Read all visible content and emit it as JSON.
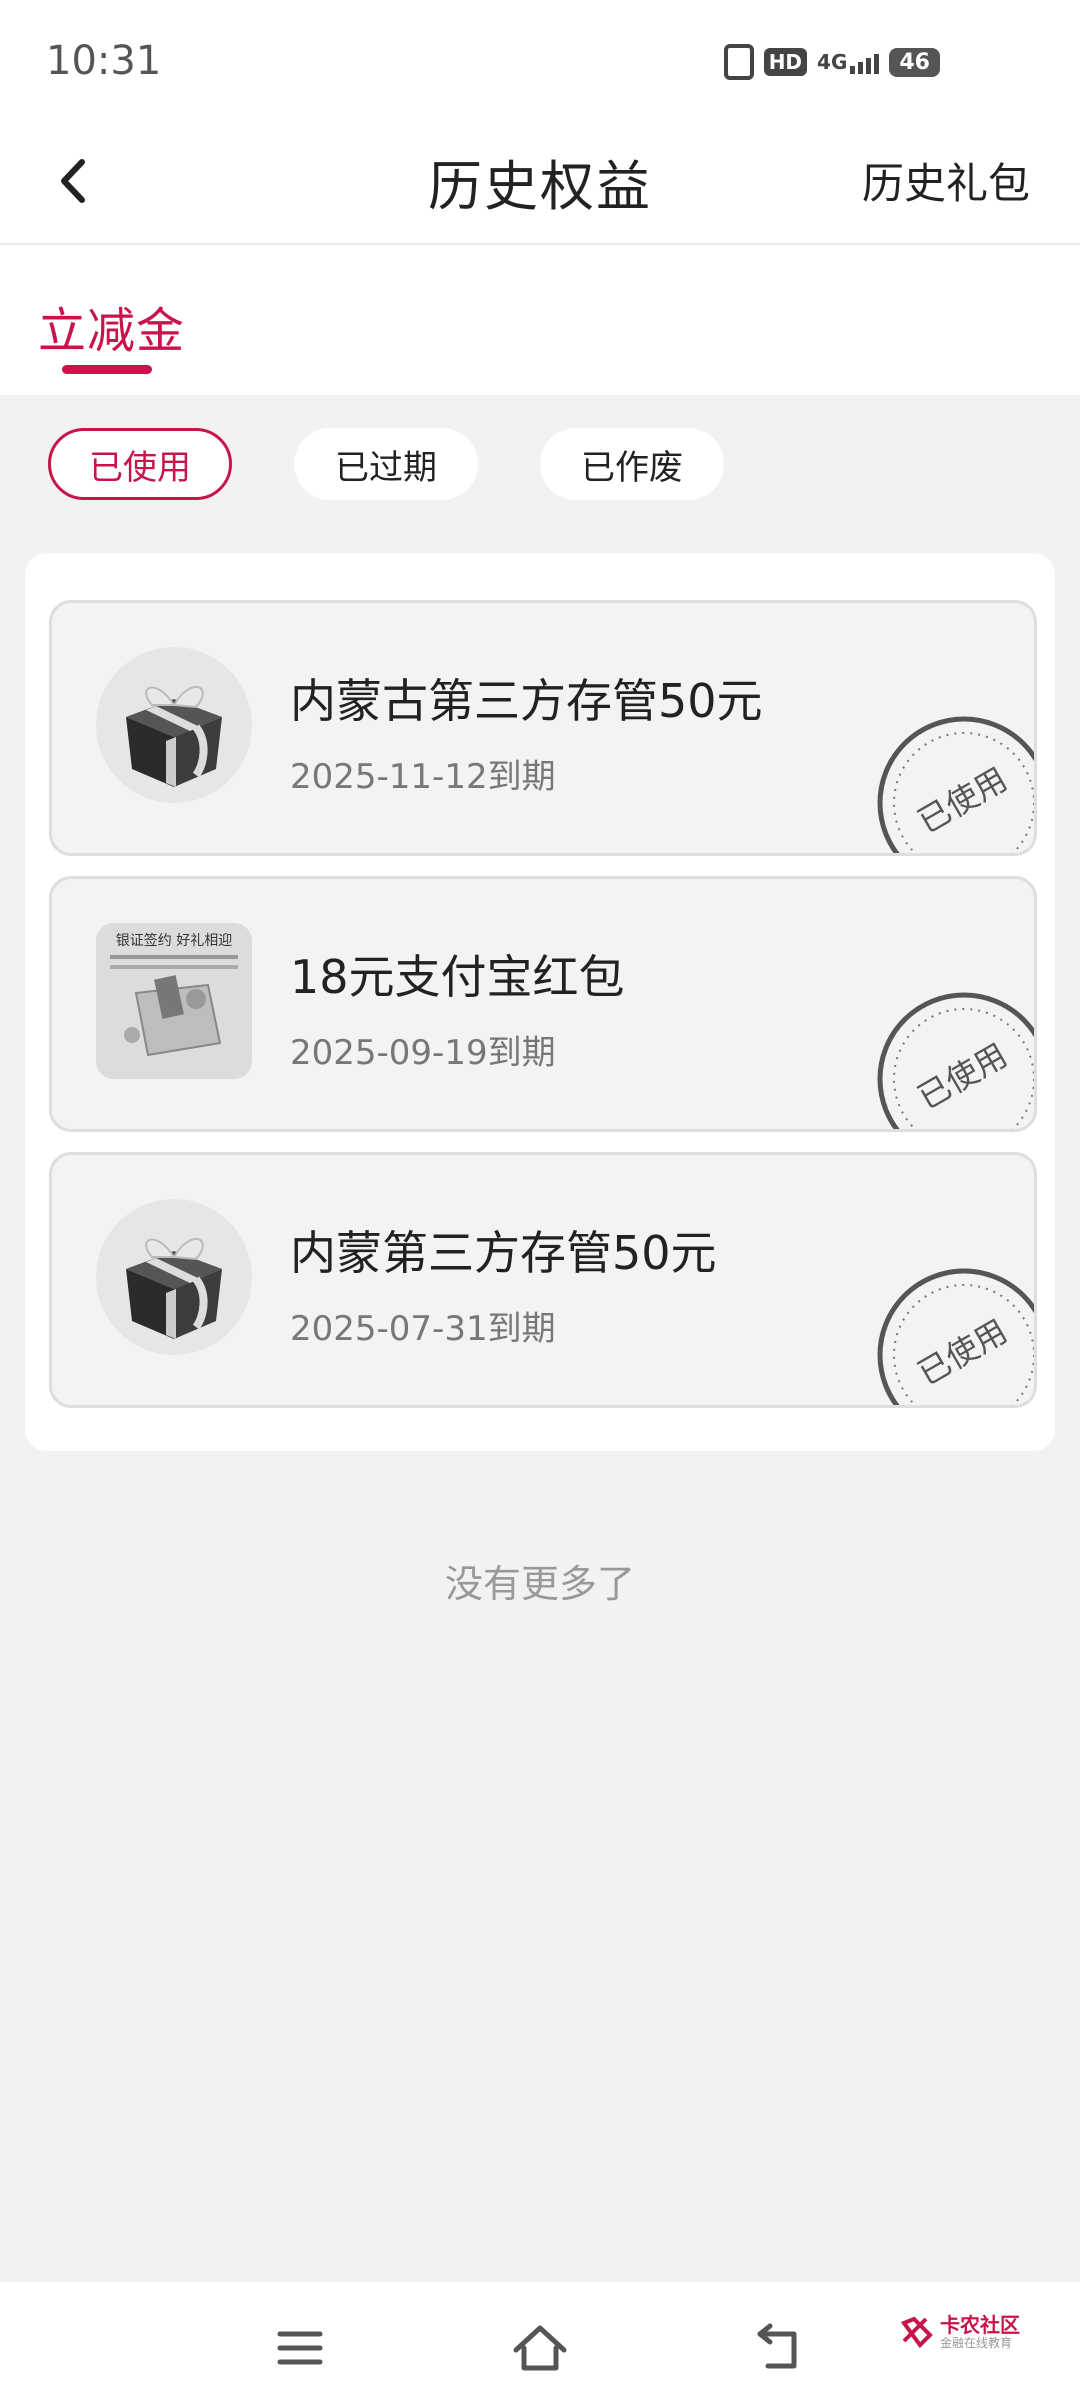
{
  "status_bar": {
    "time": "10:31",
    "hd": "HD",
    "network": "4G",
    "battery": "46"
  },
  "header": {
    "title": "历史权益",
    "right_link": "历史礼包"
  },
  "tabs": [
    {
      "label": "立减金",
      "active": true
    }
  ],
  "filters": [
    {
      "label": "已使用",
      "active": true
    },
    {
      "label": "已过期",
      "active": false
    },
    {
      "label": "已作废",
      "active": false
    }
  ],
  "coupons": [
    {
      "title": "内蒙古第三方存管50元",
      "expiry": "2025-11-12到期",
      "status": "已使用",
      "icon": "gift-box-icon"
    },
    {
      "title": "18元支付宝红包",
      "expiry": "2025-09-19到期",
      "status": "已使用",
      "icon": "promo-image",
      "image_text": {
        "headline": "银证签约 好礼相迎"
      }
    },
    {
      "title": "内蒙第三方存管50元",
      "expiry": "2025-07-31到期",
      "status": "已使用",
      "icon": "gift-box-icon"
    }
  ],
  "footer_text": "没有更多了",
  "watermark": {
    "name": "卡农社区",
    "tagline": "金融在线教育"
  },
  "colors": {
    "accent": "#c7144a",
    "page_bg": "#f2f2f2",
    "card_bg": "#f3f3f3"
  }
}
